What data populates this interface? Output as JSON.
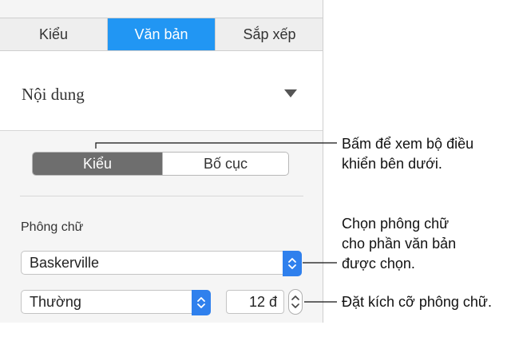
{
  "tabs": [
    {
      "label": "Kiểu",
      "active": false
    },
    {
      "label": "Văn bản",
      "active": true
    },
    {
      "label": "Sắp xếp",
      "active": false
    }
  ],
  "paragraph_style": {
    "label": "Nội dung"
  },
  "segmented": {
    "left_label": "Kiểu",
    "right_label": "Bố cục",
    "selected": "Kiểu"
  },
  "font_section": {
    "heading": "Phông chữ",
    "font_name": "Baskerville",
    "font_weight": "Thường",
    "font_size": "12 đ"
  },
  "callouts": {
    "segmented_line1": "Bấm để xem bộ điều",
    "segmented_line2": "khiển bên dưới.",
    "font_line1": "Chọn phông chữ",
    "font_line2": "cho phần văn bản",
    "font_line3": "được chọn.",
    "size_line1": "Đặt kích cỡ phông chữ."
  },
  "colors": {
    "accent": "#2196f3",
    "selected_segment": "#6e6e6e"
  }
}
